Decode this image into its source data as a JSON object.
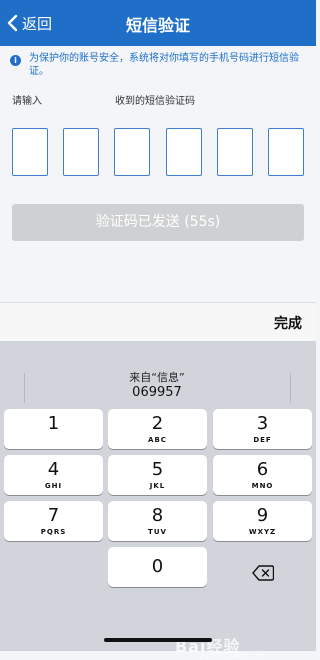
{
  "nav": {
    "back_label": "返回",
    "title": "短信验证",
    "bg_color": "#1f6fc9"
  },
  "notice": {
    "icon": "info-icon",
    "icon_glyph": "i",
    "text": "为保护你的账号安全，系统将对你填写的手机号码进行短信验证。"
  },
  "prompt": {
    "left": "请输入",
    "right": "收到的短信验证码"
  },
  "code_inputs": [
    "",
    "",
    "",
    "",
    "",
    ""
  ],
  "send_button": {
    "label": "验证码已发送 (55s)",
    "disabled": true
  },
  "toolbar": {
    "done_label": "完成"
  },
  "keyboard": {
    "suggestion": {
      "from": "来自“信息”",
      "code": "069957"
    },
    "keys": [
      {
        "num": "1",
        "letters": ""
      },
      {
        "num": "2",
        "letters": "ABC"
      },
      {
        "num": "3",
        "letters": "DEF"
      },
      {
        "num": "4",
        "letters": "GHI"
      },
      {
        "num": "5",
        "letters": "JKL"
      },
      {
        "num": "6",
        "letters": "MNO"
      },
      {
        "num": "7",
        "letters": "PQRS"
      },
      {
        "num": "8",
        "letters": "TUV"
      },
      {
        "num": "9",
        "letters": "WXYZ"
      },
      {
        "num": "0",
        "letters": ""
      }
    ],
    "delete_icon": "backspace-icon"
  },
  "watermark": {
    "logo": "Bai经验",
    "url": "jingyan.baidu.com"
  }
}
